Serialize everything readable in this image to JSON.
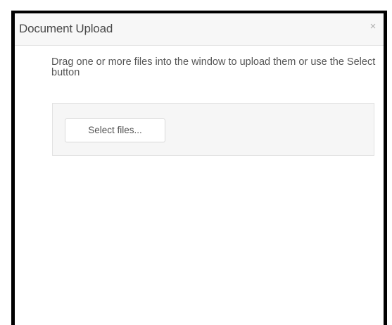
{
  "dialog": {
    "title": "Document Upload",
    "close_icon": "close-icon",
    "close_glyph": "×"
  },
  "upload": {
    "instructions": "Drag one or more files into the window to upload them or use the Select button",
    "select_label": "Select files..."
  }
}
